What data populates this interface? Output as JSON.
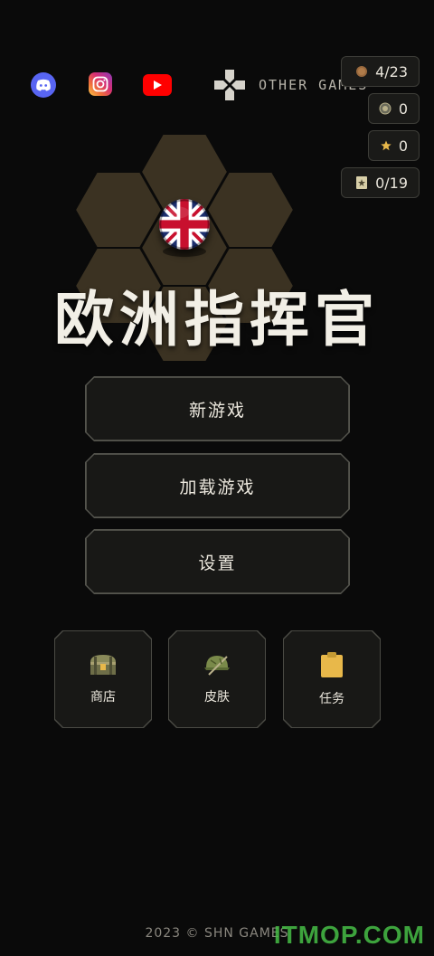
{
  "social": {
    "discord": "discord-icon",
    "instagram": "instagram-icon",
    "youtube": "youtube-icon",
    "other_games_label": "OTHER GAMES"
  },
  "counters": {
    "coins": "4/23",
    "medals": "0",
    "stars": "0",
    "cards": "0/19"
  },
  "game": {
    "title": "欧洲指挥官",
    "nation_flag": "union-jack"
  },
  "menu": {
    "new_game": "新游戏",
    "load_game": "加载游戏",
    "settings": "设置"
  },
  "tiles": {
    "shop": "商店",
    "skins": "皮肤",
    "tasks": "任务"
  },
  "footer": {
    "copyright": "2023 © SHN GAMES",
    "watermark": "ITMOP.COM"
  },
  "colors": {
    "background": "#0a0a0a",
    "hex_fill": "#3b3222",
    "accent_gold": "#e8b84a"
  }
}
